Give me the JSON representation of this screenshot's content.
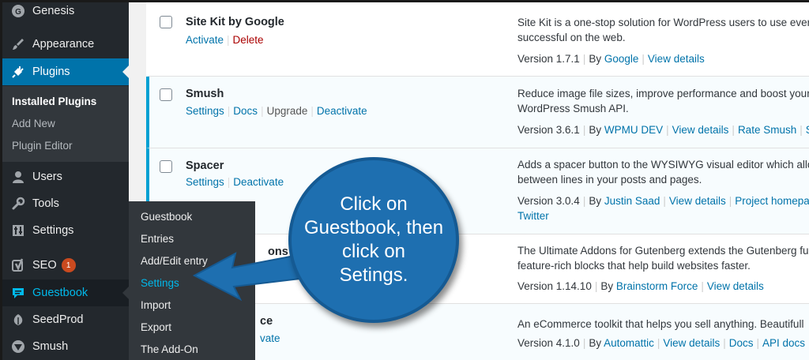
{
  "sidebar": {
    "items": [
      {
        "label": "Genesis",
        "icon": "genesis-icon"
      },
      {
        "label": "Appearance",
        "icon": "paintbrush-icon"
      },
      {
        "label": "Plugins",
        "icon": "plugin-icon"
      },
      {
        "label": "Users",
        "icon": "users-icon"
      },
      {
        "label": "Tools",
        "icon": "wrench-icon"
      },
      {
        "label": "Settings",
        "icon": "settings-icon"
      },
      {
        "label": "SEO",
        "icon": "yoast-icon",
        "badge": "1"
      },
      {
        "label": "Guestbook",
        "icon": "guestbook-icon"
      },
      {
        "label": "SeedProd",
        "icon": "seedprod-icon"
      },
      {
        "label": "Smush",
        "icon": "smush-icon"
      }
    ],
    "plugins_submenu": [
      "Installed Plugins",
      "Add New",
      "Plugin Editor"
    ]
  },
  "flyout": {
    "items": [
      "Guestbook",
      "Entries",
      "Add/Edit entry",
      "Settings",
      "Import",
      "Export",
      "The Add-On"
    ]
  },
  "plugins": [
    {
      "name": "Site Kit by Google",
      "actions": [
        "Activate",
        "Delete"
      ],
      "desc1": "Site Kit is a one-stop solution for WordPress users to use ever",
      "desc2": "successful on the web.",
      "version": "Version 1.7.1",
      "by_prefix": "By",
      "author": "Google",
      "links": [
        "View details"
      ]
    },
    {
      "name": "Smush",
      "actions": [
        "Settings",
        "Docs",
        "Upgrade",
        "Deactivate"
      ],
      "desc1": "Reduce image file sizes, improve performance and boost your",
      "desc2": "WordPress Smush API.",
      "version": "Version 3.6.1",
      "by_prefix": "By",
      "author": "WPMU DEV",
      "links": [
        "View details",
        "Rate Smush",
        "Su"
      ]
    },
    {
      "name": "Spacer",
      "actions": [
        "Settings",
        "Deactivate"
      ],
      "desc1": "Adds a spacer button to the WYSIWYG visual editor which allo",
      "desc2": "between lines in your posts and pages.",
      "version": "Version 3.0.4",
      "by_prefix": "By",
      "author": "Justin Saad",
      "links": [
        "View details",
        "Project homepag"
      ],
      "extra_line": "Twitter"
    },
    {
      "name": "ons f",
      "actions": [],
      "desc1": "The Ultimate Addons for Gutenberg extends the Gutenberg fu",
      "desc2": "feature-rich blocks that help build websites faster.",
      "version": "Version 1.14.10",
      "by_prefix": "By",
      "author": "Brainstorm Force",
      "links": [
        "View details"
      ]
    },
    {
      "name": "ce",
      "actions": [
        "vate"
      ],
      "desc1": "An eCommerce toolkit that helps you sell anything. Beautifull",
      "desc2": "",
      "version": "Version 4.1.0",
      "by_prefix": "By",
      "author": "Automattic",
      "links": [
        "View details",
        "Docs",
        "API docs"
      ]
    }
  ],
  "callout": {
    "lines": [
      "Click on",
      "Guestbook, then",
      "click on",
      "Setings."
    ]
  },
  "colors": {
    "sidebar_bg": "#23282d",
    "accent": "#0073aa",
    "callout": "#1e6fb0",
    "active_border": "#00a0d2"
  }
}
